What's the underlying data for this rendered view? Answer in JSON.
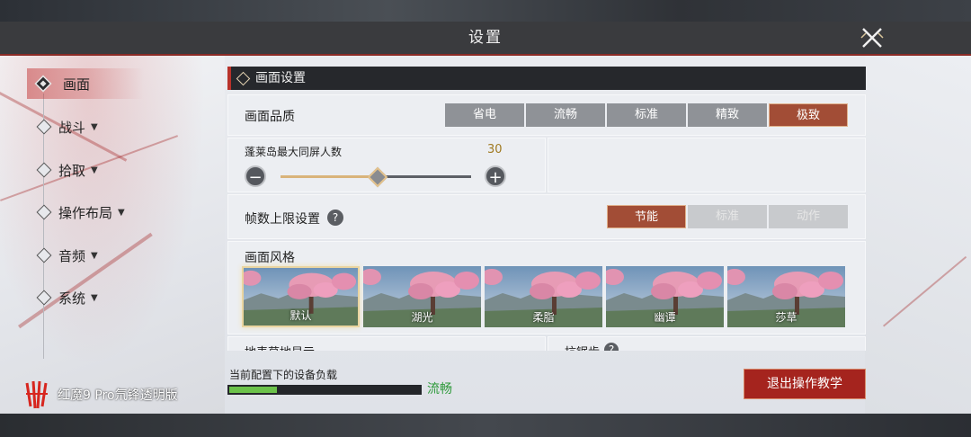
{
  "window": {
    "title": "设置"
  },
  "sidebar": {
    "items": [
      {
        "label": "画面",
        "active": true
      },
      {
        "label": "战斗"
      },
      {
        "label": "拾取"
      },
      {
        "label": "操作布局"
      },
      {
        "label": "音频"
      },
      {
        "label": "系统"
      }
    ]
  },
  "brand": {
    "text": "红魔9 Pro氘锋透明版"
  },
  "section": {
    "title": "画面设置"
  },
  "quality": {
    "label": "画面品质",
    "options": [
      "省电",
      "流畅",
      "标准",
      "精致",
      "极致"
    ],
    "selected": "极致"
  },
  "players": {
    "label": "蓬莱岛最大同屏人数",
    "value": "30",
    "level": 0.5
  },
  "framerate": {
    "label": "帧数上限设置",
    "help": "?",
    "options": [
      "节能",
      "标准",
      "动作"
    ],
    "selected": "节能"
  },
  "style": {
    "label": "画面风格",
    "options": [
      "默认",
      "湖光",
      "柔脂",
      "幽谭",
      "莎草"
    ],
    "selected": "默认"
  },
  "partial_rows": {
    "left": "地表草地显示",
    "right": "抗锯齿",
    "right_help": "?"
  },
  "device_load": {
    "label": "当前配置下的设备负载",
    "status": "流畅",
    "level": 0.25
  },
  "exit_button": {
    "label": "退出操作教学"
  },
  "colors": {
    "accent": "#a24d36",
    "status_ok": "#2f9a3b",
    "slider_value": "#a07a22"
  }
}
